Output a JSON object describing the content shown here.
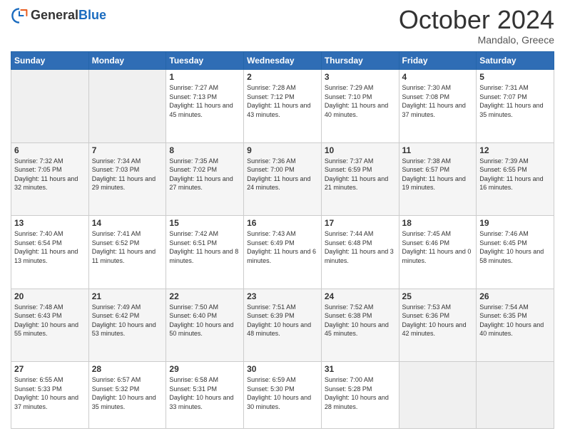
{
  "header": {
    "logo_general": "General",
    "logo_blue": "Blue",
    "month_title": "October 2024",
    "location": "Mandalo, Greece"
  },
  "days_of_week": [
    "Sunday",
    "Monday",
    "Tuesday",
    "Wednesday",
    "Thursday",
    "Friday",
    "Saturday"
  ],
  "weeks": [
    [
      {
        "day": "",
        "info": ""
      },
      {
        "day": "",
        "info": ""
      },
      {
        "day": "1",
        "info": "Sunrise: 7:27 AM\nSunset: 7:13 PM\nDaylight: 11 hours and 45 minutes."
      },
      {
        "day": "2",
        "info": "Sunrise: 7:28 AM\nSunset: 7:12 PM\nDaylight: 11 hours and 43 minutes."
      },
      {
        "day": "3",
        "info": "Sunrise: 7:29 AM\nSunset: 7:10 PM\nDaylight: 11 hours and 40 minutes."
      },
      {
        "day": "4",
        "info": "Sunrise: 7:30 AM\nSunset: 7:08 PM\nDaylight: 11 hours and 37 minutes."
      },
      {
        "day": "5",
        "info": "Sunrise: 7:31 AM\nSunset: 7:07 PM\nDaylight: 11 hours and 35 minutes."
      }
    ],
    [
      {
        "day": "6",
        "info": "Sunrise: 7:32 AM\nSunset: 7:05 PM\nDaylight: 11 hours and 32 minutes."
      },
      {
        "day": "7",
        "info": "Sunrise: 7:34 AM\nSunset: 7:03 PM\nDaylight: 11 hours and 29 minutes."
      },
      {
        "day": "8",
        "info": "Sunrise: 7:35 AM\nSunset: 7:02 PM\nDaylight: 11 hours and 27 minutes."
      },
      {
        "day": "9",
        "info": "Sunrise: 7:36 AM\nSunset: 7:00 PM\nDaylight: 11 hours and 24 minutes."
      },
      {
        "day": "10",
        "info": "Sunrise: 7:37 AM\nSunset: 6:59 PM\nDaylight: 11 hours and 21 minutes."
      },
      {
        "day": "11",
        "info": "Sunrise: 7:38 AM\nSunset: 6:57 PM\nDaylight: 11 hours and 19 minutes."
      },
      {
        "day": "12",
        "info": "Sunrise: 7:39 AM\nSunset: 6:55 PM\nDaylight: 11 hours and 16 minutes."
      }
    ],
    [
      {
        "day": "13",
        "info": "Sunrise: 7:40 AM\nSunset: 6:54 PM\nDaylight: 11 hours and 13 minutes."
      },
      {
        "day": "14",
        "info": "Sunrise: 7:41 AM\nSunset: 6:52 PM\nDaylight: 11 hours and 11 minutes."
      },
      {
        "day": "15",
        "info": "Sunrise: 7:42 AM\nSunset: 6:51 PM\nDaylight: 11 hours and 8 minutes."
      },
      {
        "day": "16",
        "info": "Sunrise: 7:43 AM\nSunset: 6:49 PM\nDaylight: 11 hours and 6 minutes."
      },
      {
        "day": "17",
        "info": "Sunrise: 7:44 AM\nSunset: 6:48 PM\nDaylight: 11 hours and 3 minutes."
      },
      {
        "day": "18",
        "info": "Sunrise: 7:45 AM\nSunset: 6:46 PM\nDaylight: 11 hours and 0 minutes."
      },
      {
        "day": "19",
        "info": "Sunrise: 7:46 AM\nSunset: 6:45 PM\nDaylight: 10 hours and 58 minutes."
      }
    ],
    [
      {
        "day": "20",
        "info": "Sunrise: 7:48 AM\nSunset: 6:43 PM\nDaylight: 10 hours and 55 minutes."
      },
      {
        "day": "21",
        "info": "Sunrise: 7:49 AM\nSunset: 6:42 PM\nDaylight: 10 hours and 53 minutes."
      },
      {
        "day": "22",
        "info": "Sunrise: 7:50 AM\nSunset: 6:40 PM\nDaylight: 10 hours and 50 minutes."
      },
      {
        "day": "23",
        "info": "Sunrise: 7:51 AM\nSunset: 6:39 PM\nDaylight: 10 hours and 48 minutes."
      },
      {
        "day": "24",
        "info": "Sunrise: 7:52 AM\nSunset: 6:38 PM\nDaylight: 10 hours and 45 minutes."
      },
      {
        "day": "25",
        "info": "Sunrise: 7:53 AM\nSunset: 6:36 PM\nDaylight: 10 hours and 42 minutes."
      },
      {
        "day": "26",
        "info": "Sunrise: 7:54 AM\nSunset: 6:35 PM\nDaylight: 10 hours and 40 minutes."
      }
    ],
    [
      {
        "day": "27",
        "info": "Sunrise: 6:55 AM\nSunset: 5:33 PM\nDaylight: 10 hours and 37 minutes."
      },
      {
        "day": "28",
        "info": "Sunrise: 6:57 AM\nSunset: 5:32 PM\nDaylight: 10 hours and 35 minutes."
      },
      {
        "day": "29",
        "info": "Sunrise: 6:58 AM\nSunset: 5:31 PM\nDaylight: 10 hours and 33 minutes."
      },
      {
        "day": "30",
        "info": "Sunrise: 6:59 AM\nSunset: 5:30 PM\nDaylight: 10 hours and 30 minutes."
      },
      {
        "day": "31",
        "info": "Sunrise: 7:00 AM\nSunset: 5:28 PM\nDaylight: 10 hours and 28 minutes."
      },
      {
        "day": "",
        "info": ""
      },
      {
        "day": "",
        "info": ""
      }
    ]
  ]
}
